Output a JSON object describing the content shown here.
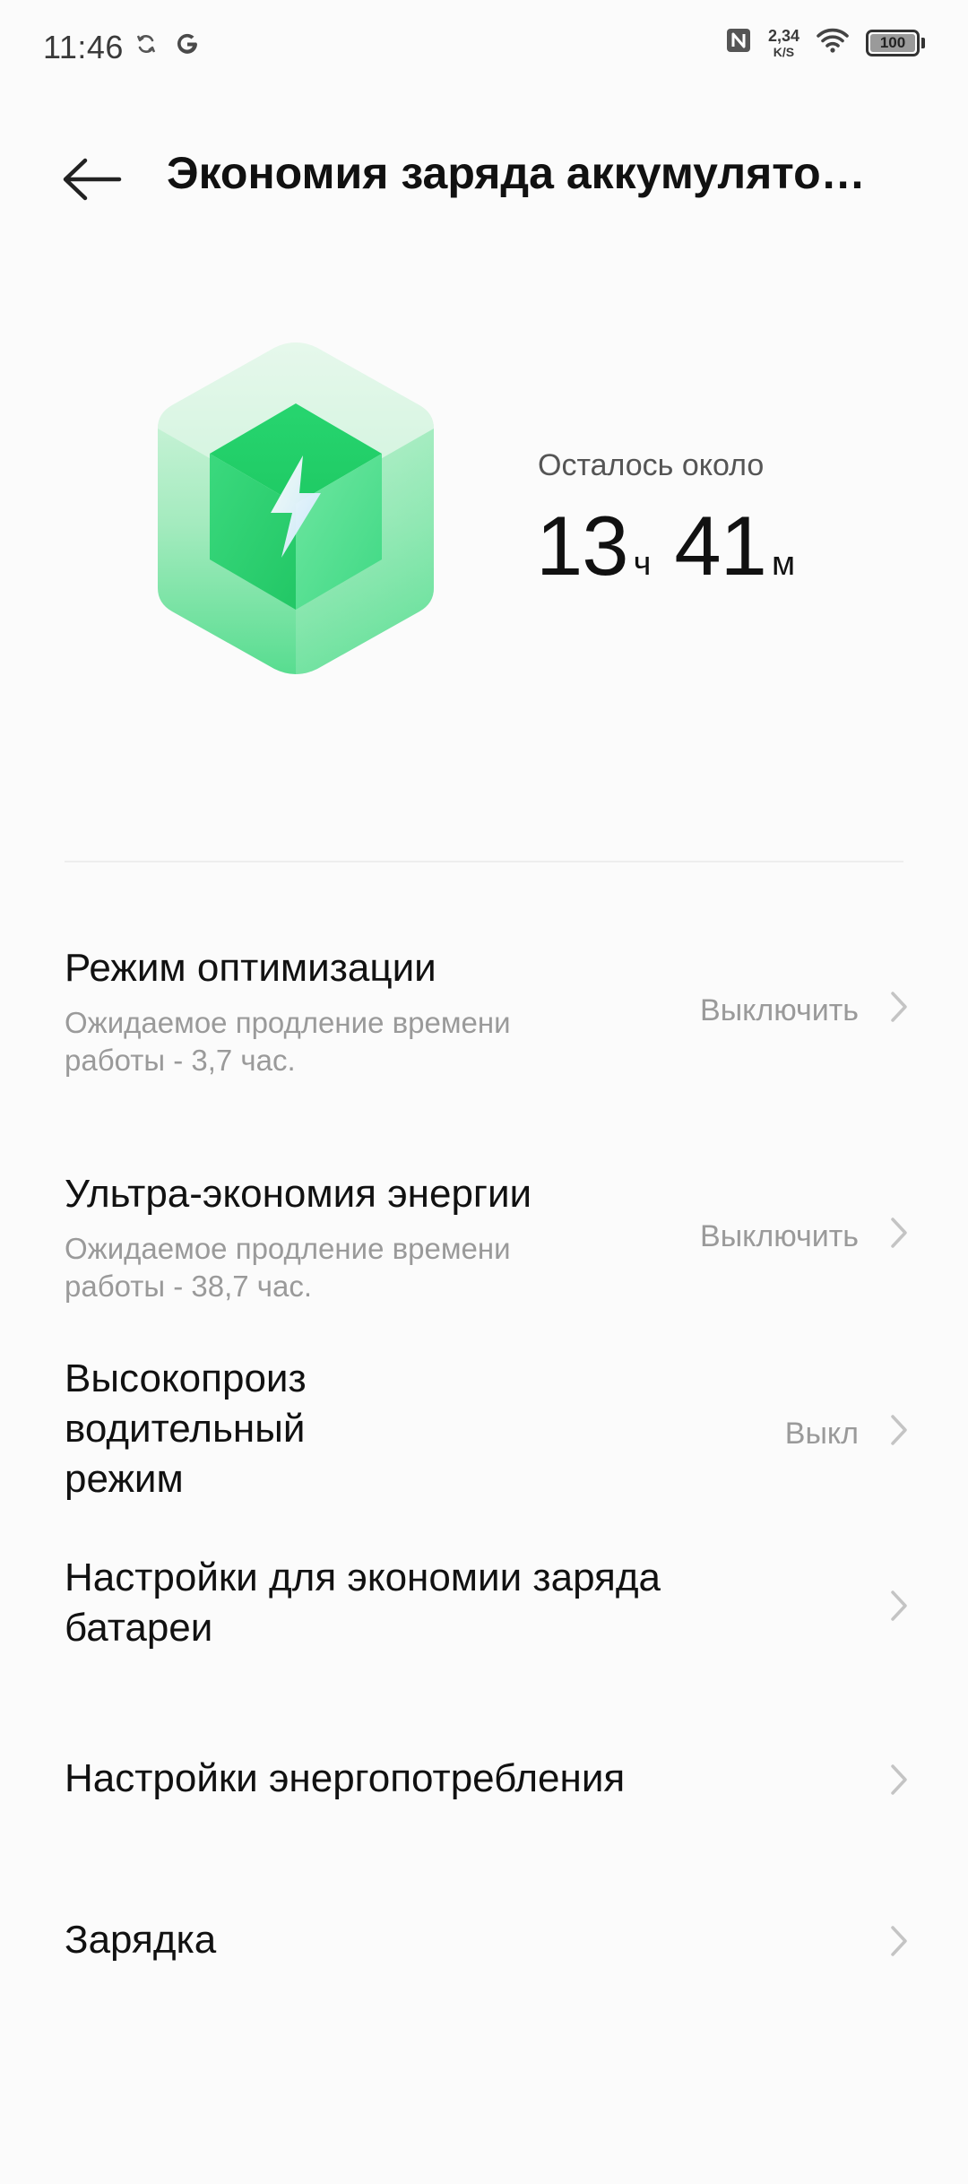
{
  "status_bar": {
    "time": "11:46",
    "net_speed_value": "2,34",
    "net_speed_unit": "K/S",
    "battery_level": "100",
    "battery_fraction": 1.0,
    "left_icons": [
      "sync-icon",
      "google-g-icon"
    ],
    "right_icons": [
      "nfc-icon",
      "wifi-icon",
      "battery-icon"
    ]
  },
  "header": {
    "back_icon": "arrow-left-icon",
    "title": "Экономия заряда аккумулято…"
  },
  "hero": {
    "remaining_label": "Осталось около",
    "hours": "13",
    "hours_unit": "ч",
    "minutes": "41",
    "minutes_unit": "м",
    "illustration": "battery-cube-icon"
  },
  "settings": [
    {
      "title": "Режим оптимизации",
      "subtitle": "Ожидаемое продление времени работы - 3,7 час.",
      "value": "Выключить"
    },
    {
      "title": "Ультра-экономия энергии",
      "subtitle": "Ожидаемое продление времени работы - 38,7 час.",
      "value": "Выключить"
    },
    {
      "title_line1": "Высокопроиз",
      "title_line2": "водительный",
      "title_line3": "режим",
      "value": "Выкл"
    },
    {
      "title_line1": "Настройки для экономии заряда",
      "title_line2": "батареи"
    },
    {
      "title": "Настройки энергопотребления"
    },
    {
      "title": "Зарядка"
    }
  ],
  "colors": {
    "accent_green": "#1fd36f",
    "background": "#fbfbfb",
    "secondary_text": "#9a9a9a"
  }
}
